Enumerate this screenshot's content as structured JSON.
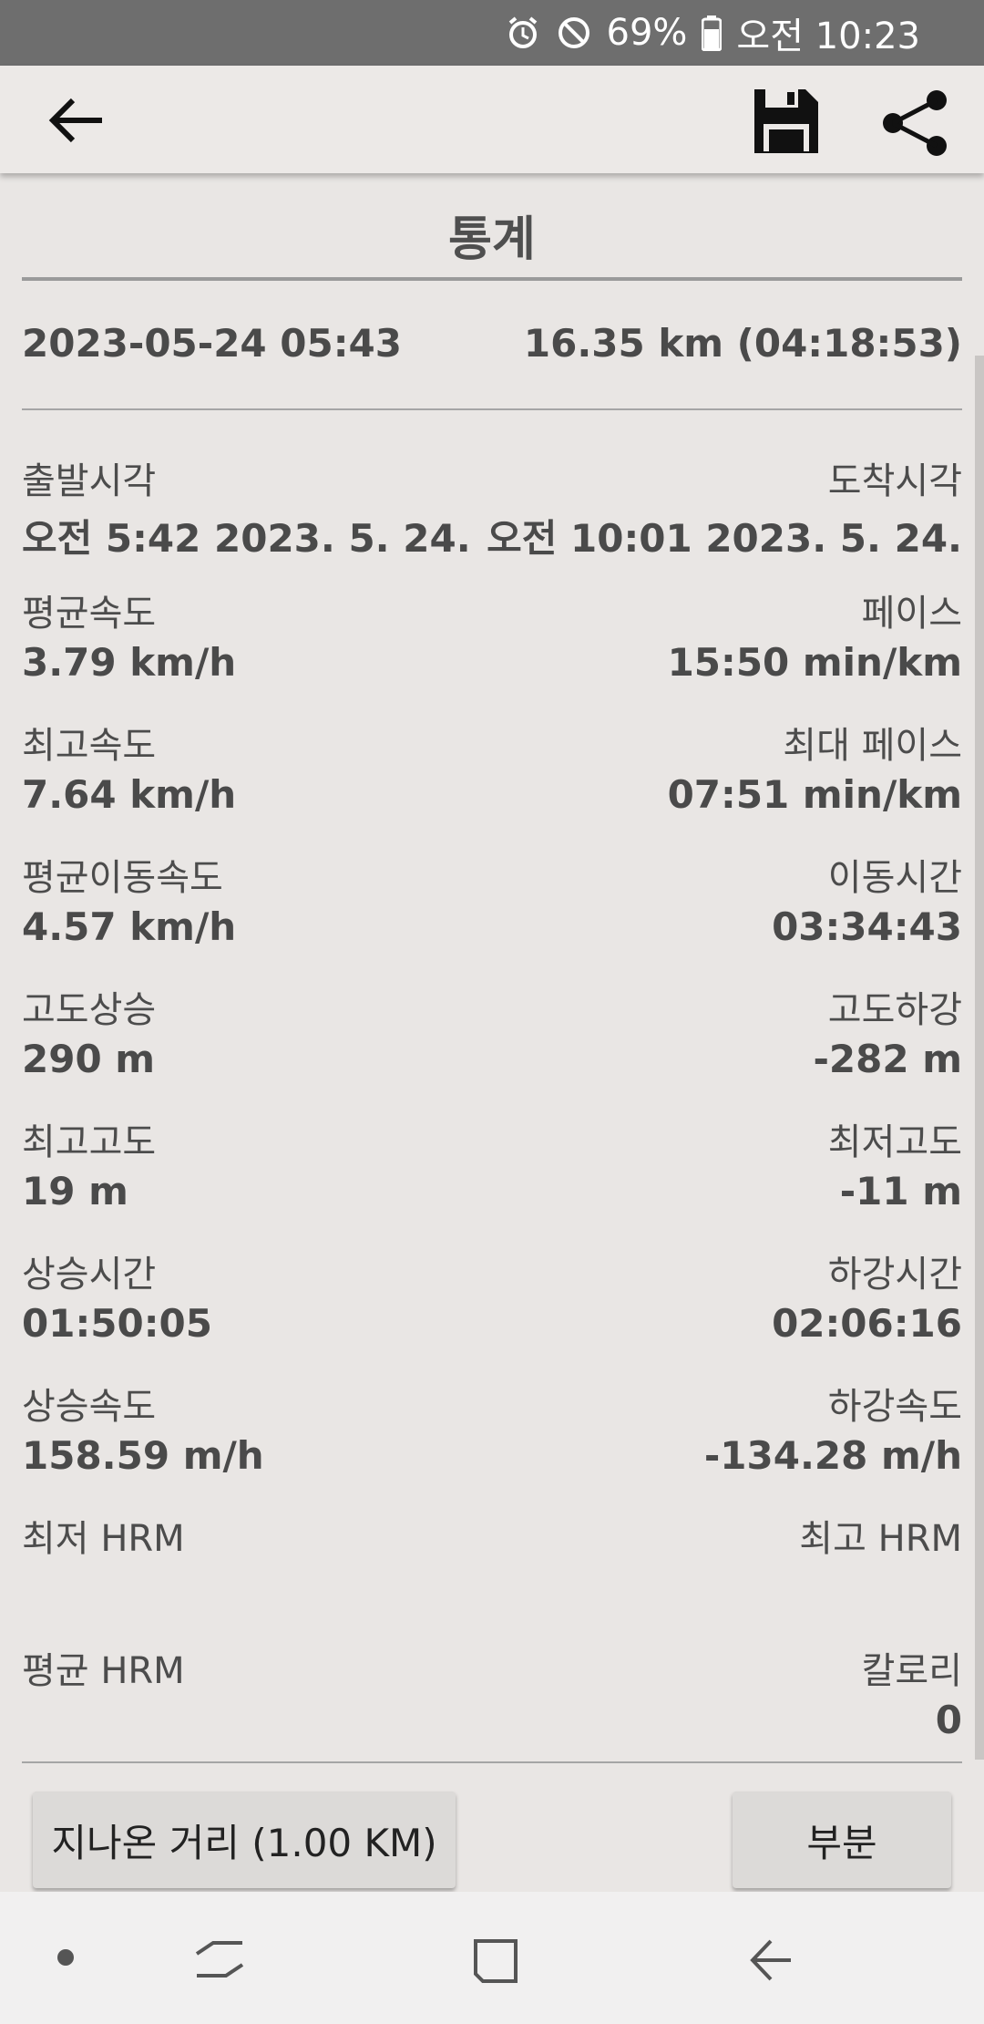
{
  "status_bar": {
    "battery": "69%",
    "time": "오전 10:23"
  },
  "icons": {
    "back": "arrow-left-icon",
    "save": "floppy-disk-icon",
    "share": "share-icon",
    "alarm": "alarm-icon",
    "dnd": "do-not-disturb-icon",
    "battery": "battery-icon"
  },
  "page": {
    "title": "통계",
    "summary_date": "2023-05-24 05:43",
    "summary_distance": "16.35 km (04:18:53)"
  },
  "stats": [
    {
      "left_label": "출발시각",
      "left_value": "오전 5:42 2023. 5. 24.",
      "right_label": "도착시각",
      "right_value": "오전 10:01 2023. 5. 24."
    },
    {
      "left_label": "평균속도",
      "left_value": "3.79 km/h",
      "right_label": "페이스",
      "right_value": "15:50 min/km"
    },
    {
      "left_label": "최고속도",
      "left_value": "7.64 km/h",
      "right_label": "최대 페이스",
      "right_value": "07:51 min/km"
    },
    {
      "left_label": "평균이동속도",
      "left_value": "4.57 km/h",
      "right_label": "이동시간",
      "right_value": "03:34:43"
    },
    {
      "left_label": "고도상승",
      "left_value": "290 m",
      "right_label": "고도하강",
      "right_value": "-282 m"
    },
    {
      "left_label": "최고고도",
      "left_value": "19 m",
      "right_label": "최저고도",
      "right_value": "-11 m"
    },
    {
      "left_label": "상승시간",
      "left_value": "01:50:05",
      "right_label": "하강시간",
      "right_value": "02:06:16"
    },
    {
      "left_label": "상승속도",
      "left_value": "158.59 m/h",
      "right_label": "하강속도",
      "right_value": "-134.28 m/h"
    },
    {
      "left_label": "최저 HRM",
      "left_value": "",
      "right_label": "최고 HRM",
      "right_value": ""
    },
    {
      "left_label": "평균 HRM",
      "left_value": "",
      "right_label": "칼로리",
      "right_value": "0"
    }
  ],
  "buttons": {
    "distance": "지나온 거리 (1.00  KM)",
    "part": "부분"
  }
}
